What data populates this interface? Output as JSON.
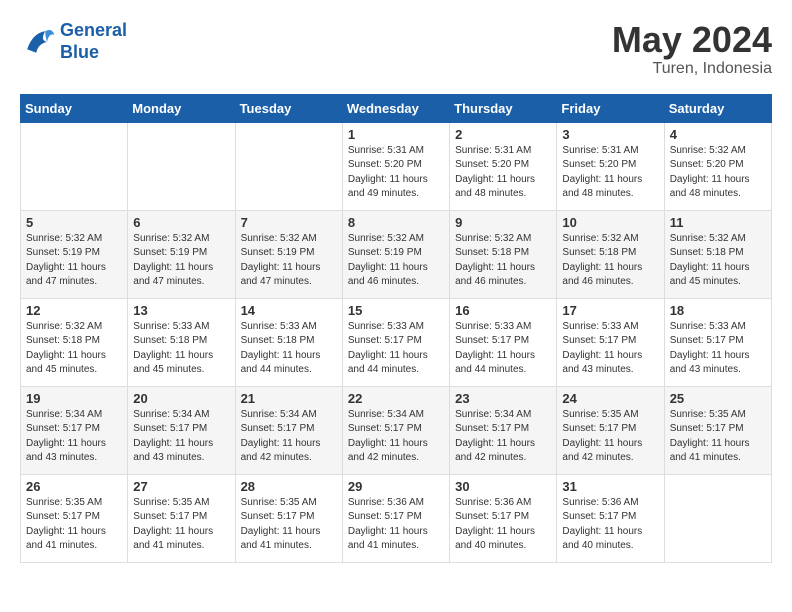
{
  "header": {
    "logo_line1": "General",
    "logo_line2": "Blue",
    "title": "May 2024",
    "location": "Turen, Indonesia"
  },
  "weekdays": [
    "Sunday",
    "Monday",
    "Tuesday",
    "Wednesday",
    "Thursday",
    "Friday",
    "Saturday"
  ],
  "weeks": [
    [
      {
        "date": "",
        "sunrise": "",
        "sunset": "",
        "daylight": ""
      },
      {
        "date": "",
        "sunrise": "",
        "sunset": "",
        "daylight": ""
      },
      {
        "date": "",
        "sunrise": "",
        "sunset": "",
        "daylight": ""
      },
      {
        "date": "1",
        "sunrise": "Sunrise: 5:31 AM",
        "sunset": "Sunset: 5:20 PM",
        "daylight": "Daylight: 11 hours and 49 minutes."
      },
      {
        "date": "2",
        "sunrise": "Sunrise: 5:31 AM",
        "sunset": "Sunset: 5:20 PM",
        "daylight": "Daylight: 11 hours and 48 minutes."
      },
      {
        "date": "3",
        "sunrise": "Sunrise: 5:31 AM",
        "sunset": "Sunset: 5:20 PM",
        "daylight": "Daylight: 11 hours and 48 minutes."
      },
      {
        "date": "4",
        "sunrise": "Sunrise: 5:32 AM",
        "sunset": "Sunset: 5:20 PM",
        "daylight": "Daylight: 11 hours and 48 minutes."
      }
    ],
    [
      {
        "date": "5",
        "sunrise": "Sunrise: 5:32 AM",
        "sunset": "Sunset: 5:19 PM",
        "daylight": "Daylight: 11 hours and 47 minutes."
      },
      {
        "date": "6",
        "sunrise": "Sunrise: 5:32 AM",
        "sunset": "Sunset: 5:19 PM",
        "daylight": "Daylight: 11 hours and 47 minutes."
      },
      {
        "date": "7",
        "sunrise": "Sunrise: 5:32 AM",
        "sunset": "Sunset: 5:19 PM",
        "daylight": "Daylight: 11 hours and 47 minutes."
      },
      {
        "date": "8",
        "sunrise": "Sunrise: 5:32 AM",
        "sunset": "Sunset: 5:19 PM",
        "daylight": "Daylight: 11 hours and 46 minutes."
      },
      {
        "date": "9",
        "sunrise": "Sunrise: 5:32 AM",
        "sunset": "Sunset: 5:18 PM",
        "daylight": "Daylight: 11 hours and 46 minutes."
      },
      {
        "date": "10",
        "sunrise": "Sunrise: 5:32 AM",
        "sunset": "Sunset: 5:18 PM",
        "daylight": "Daylight: 11 hours and 46 minutes."
      },
      {
        "date": "11",
        "sunrise": "Sunrise: 5:32 AM",
        "sunset": "Sunset: 5:18 PM",
        "daylight": "Daylight: 11 hours and 45 minutes."
      }
    ],
    [
      {
        "date": "12",
        "sunrise": "Sunrise: 5:32 AM",
        "sunset": "Sunset: 5:18 PM",
        "daylight": "Daylight: 11 hours and 45 minutes."
      },
      {
        "date": "13",
        "sunrise": "Sunrise: 5:33 AM",
        "sunset": "Sunset: 5:18 PM",
        "daylight": "Daylight: 11 hours and 45 minutes."
      },
      {
        "date": "14",
        "sunrise": "Sunrise: 5:33 AM",
        "sunset": "Sunset: 5:18 PM",
        "daylight": "Daylight: 11 hours and 44 minutes."
      },
      {
        "date": "15",
        "sunrise": "Sunrise: 5:33 AM",
        "sunset": "Sunset: 5:17 PM",
        "daylight": "Daylight: 11 hours and 44 minutes."
      },
      {
        "date": "16",
        "sunrise": "Sunrise: 5:33 AM",
        "sunset": "Sunset: 5:17 PM",
        "daylight": "Daylight: 11 hours and 44 minutes."
      },
      {
        "date": "17",
        "sunrise": "Sunrise: 5:33 AM",
        "sunset": "Sunset: 5:17 PM",
        "daylight": "Daylight: 11 hours and 43 minutes."
      },
      {
        "date": "18",
        "sunrise": "Sunrise: 5:33 AM",
        "sunset": "Sunset: 5:17 PM",
        "daylight": "Daylight: 11 hours and 43 minutes."
      }
    ],
    [
      {
        "date": "19",
        "sunrise": "Sunrise: 5:34 AM",
        "sunset": "Sunset: 5:17 PM",
        "daylight": "Daylight: 11 hours and 43 minutes."
      },
      {
        "date": "20",
        "sunrise": "Sunrise: 5:34 AM",
        "sunset": "Sunset: 5:17 PM",
        "daylight": "Daylight: 11 hours and 43 minutes."
      },
      {
        "date": "21",
        "sunrise": "Sunrise: 5:34 AM",
        "sunset": "Sunset: 5:17 PM",
        "daylight": "Daylight: 11 hours and 42 minutes."
      },
      {
        "date": "22",
        "sunrise": "Sunrise: 5:34 AM",
        "sunset": "Sunset: 5:17 PM",
        "daylight": "Daylight: 11 hours and 42 minutes."
      },
      {
        "date": "23",
        "sunrise": "Sunrise: 5:34 AM",
        "sunset": "Sunset: 5:17 PM",
        "daylight": "Daylight: 11 hours and 42 minutes."
      },
      {
        "date": "24",
        "sunrise": "Sunrise: 5:35 AM",
        "sunset": "Sunset: 5:17 PM",
        "daylight": "Daylight: 11 hours and 42 minutes."
      },
      {
        "date": "25",
        "sunrise": "Sunrise: 5:35 AM",
        "sunset": "Sunset: 5:17 PM",
        "daylight": "Daylight: 11 hours and 41 minutes."
      }
    ],
    [
      {
        "date": "26",
        "sunrise": "Sunrise: 5:35 AM",
        "sunset": "Sunset: 5:17 PM",
        "daylight": "Daylight: 11 hours and 41 minutes."
      },
      {
        "date": "27",
        "sunrise": "Sunrise: 5:35 AM",
        "sunset": "Sunset: 5:17 PM",
        "daylight": "Daylight: 11 hours and 41 minutes."
      },
      {
        "date": "28",
        "sunrise": "Sunrise: 5:35 AM",
        "sunset": "Sunset: 5:17 PM",
        "daylight": "Daylight: 11 hours and 41 minutes."
      },
      {
        "date": "29",
        "sunrise": "Sunrise: 5:36 AM",
        "sunset": "Sunset: 5:17 PM",
        "daylight": "Daylight: 11 hours and 41 minutes."
      },
      {
        "date": "30",
        "sunrise": "Sunrise: 5:36 AM",
        "sunset": "Sunset: 5:17 PM",
        "daylight": "Daylight: 11 hours and 40 minutes."
      },
      {
        "date": "31",
        "sunrise": "Sunrise: 5:36 AM",
        "sunset": "Sunset: 5:17 PM",
        "daylight": "Daylight: 11 hours and 40 minutes."
      },
      {
        "date": "",
        "sunrise": "",
        "sunset": "",
        "daylight": ""
      }
    ]
  ]
}
